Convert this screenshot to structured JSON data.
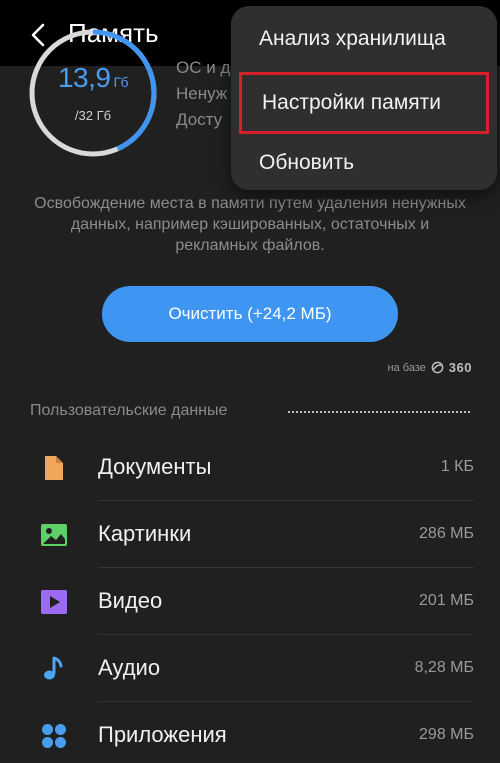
{
  "header": {
    "title": "Память"
  },
  "storage": {
    "used_value": "13,9",
    "used_unit": "Гб",
    "total": "/32 Гб",
    "used_fraction": 0.434,
    "info_lines": [
      "ОС и д",
      "Ненуж",
      "Досту"
    ]
  },
  "description": "Освобождение места в памяти путем удаления ненужных данных, например кэшированных, остаточных и рекламных файлов.",
  "clean_button": {
    "label": "Очистить (+24,2 МБ)"
  },
  "powered_by": {
    "prefix": "на базе",
    "brand": "360"
  },
  "section": {
    "title": "Пользовательские данные"
  },
  "categories": [
    {
      "name": "Документы",
      "size": "1 КБ",
      "icon": "document-icon",
      "color": "#f2a65a"
    },
    {
      "name": "Картинки",
      "size": "286 МБ",
      "icon": "image-icon",
      "color": "#5fd068"
    },
    {
      "name": "Видео",
      "size": "201 МБ",
      "icon": "video-icon",
      "color": "#9b6cf0"
    },
    {
      "name": "Аудио",
      "size": "8,28 МБ",
      "icon": "audio-icon",
      "color": "#4aa6f0"
    },
    {
      "name": "Приложения",
      "size": "298 МБ",
      "icon": "apps-icon",
      "color": "#4a9ef0"
    }
  ],
  "menu": {
    "items": [
      {
        "label": "Анализ хранилища",
        "highlighted": false
      },
      {
        "label": "Настройки памяти",
        "highlighted": true
      },
      {
        "label": "Обновить",
        "highlighted": false
      }
    ],
    "highlight_color": "#d6202a"
  },
  "colors": {
    "accent": "#3f96f2",
    "background": "#202020",
    "menu_bg": "#2f2f2f"
  }
}
